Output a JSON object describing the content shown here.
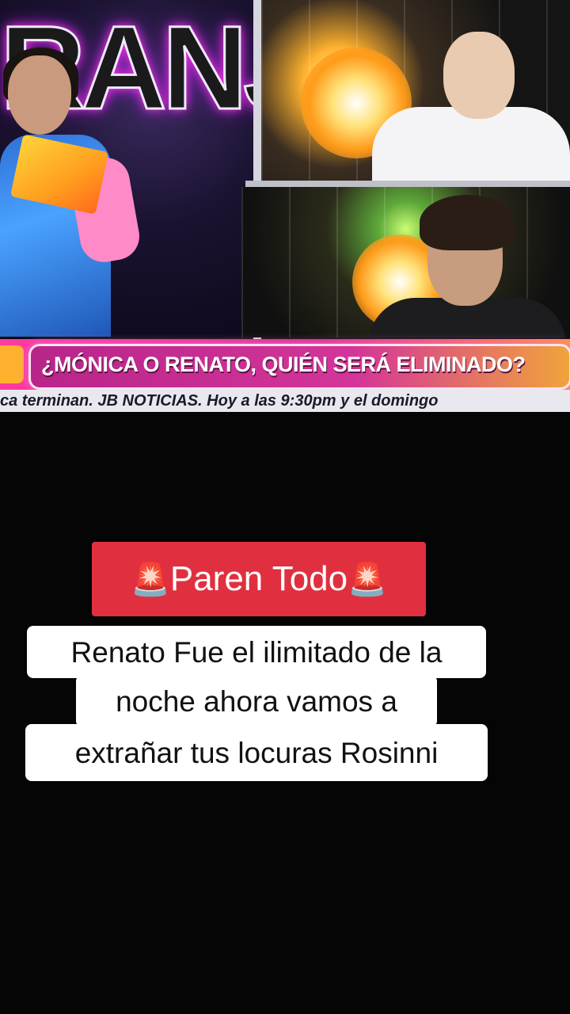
{
  "broadcast": {
    "neon_sign_text": "RANJA",
    "lower_third_text": "¿MÓNICA O RENATO, QUIÉN SERÁ ELIMINADO?",
    "ticker_text": "ca terminan. JB NOTICIAS. Hoy a las 9:30pm y el domingo"
  },
  "overlay": {
    "title_text": "Paren Todo",
    "siren_emoji": "🚨",
    "caption_lines": [
      "Renato Fue el ilimitado de la",
      "noche ahora vamos a",
      "extrañar tus locuras Rosinni"
    ],
    "title_bg_color": "#e0303f",
    "caption_bg_color": "#ffffff"
  }
}
